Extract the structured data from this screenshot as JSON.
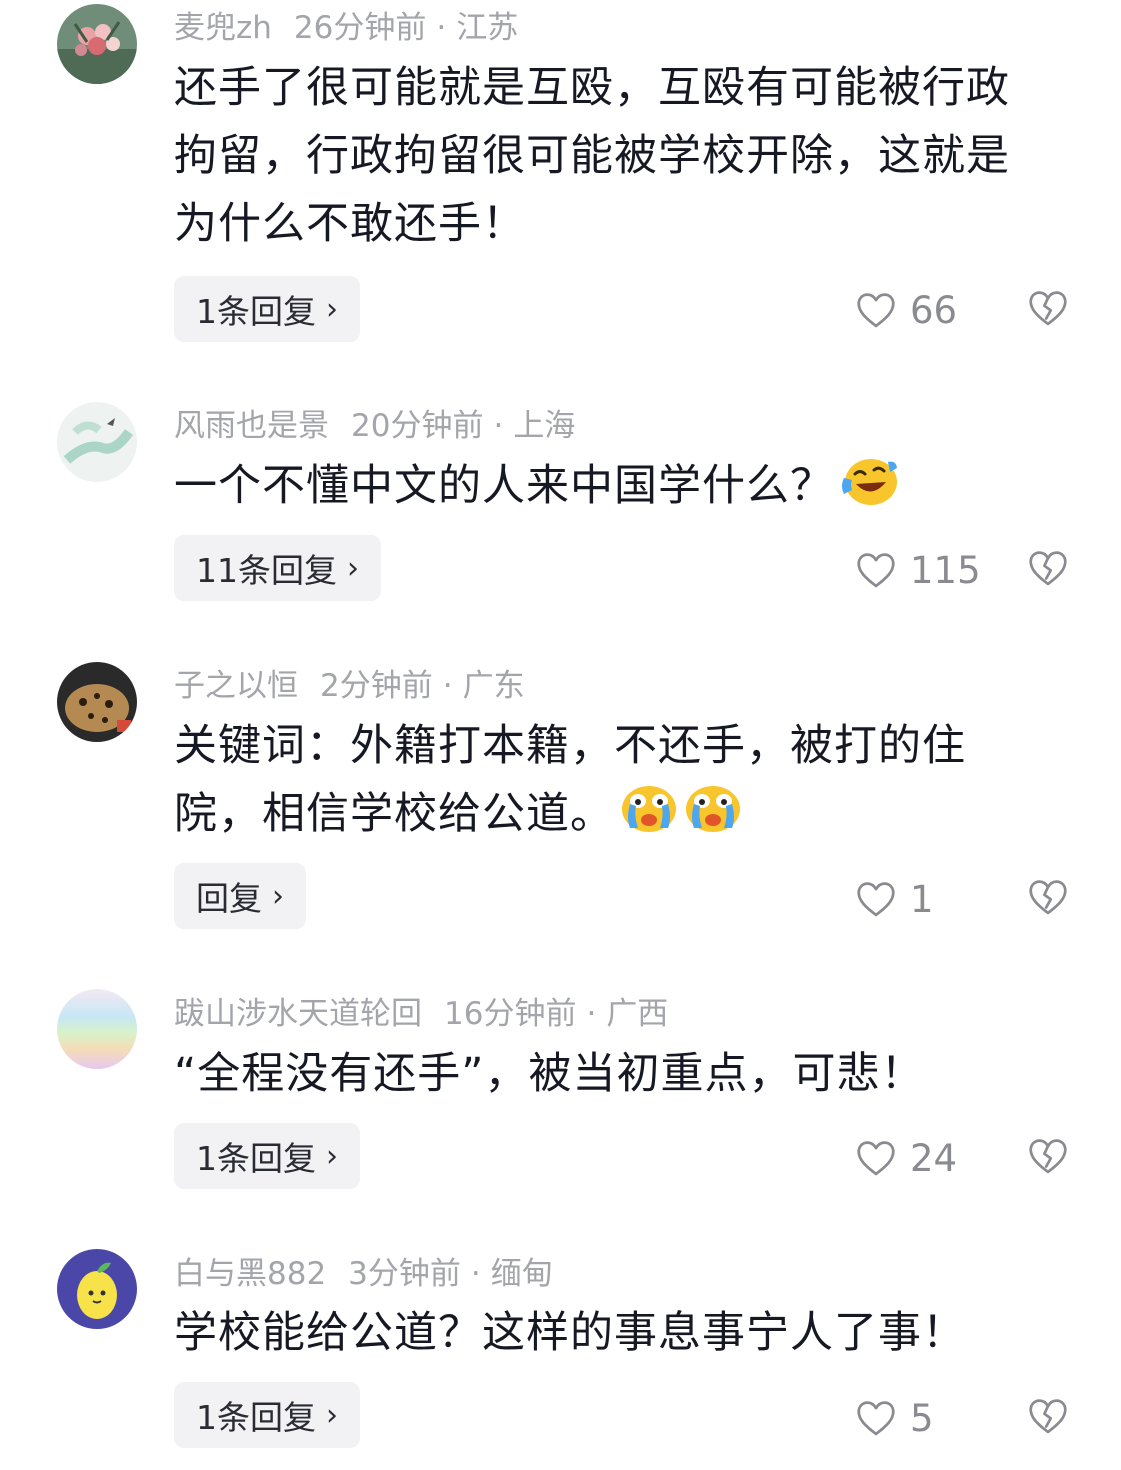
{
  "comments": [
    {
      "username": "麦兜zh",
      "time": "26分钟前",
      "location": "江苏",
      "lines": [
        "还手了很可能就是互殴，互殴有可能被行政",
        "拘留，行政拘留很可能被学校开除，这就是",
        "为什么不敢还手！"
      ],
      "reply_label": "1条回复",
      "likes": "66",
      "avatar_icon": "flower-bouquet-avatar"
    },
    {
      "username": "风雨也是景",
      "time": "20分钟前",
      "location": "上海",
      "lines": [
        "一个不懂中文的人来中国学什么？"
      ],
      "emojis": [
        "laughing-crying-emoji"
      ],
      "reply_label": "11条回复",
      "likes": "115",
      "avatar_icon": "watercolor-bird-avatar"
    },
    {
      "username": "子之以恒",
      "time": "2分钟前",
      "location": "广东",
      "lines": [
        "关键词：外籍打本籍，不还手，被打的住",
        "院，相信学校给公道。"
      ],
      "emojis": [
        "crying-emoji",
        "crying-emoji"
      ],
      "reply_label": "回复",
      "likes": "1",
      "avatar_icon": "leopard-avatar"
    },
    {
      "username": "跋山涉水天道轮回",
      "time": "16分钟前",
      "location": "广西",
      "lines": [
        "“全程没有还手”，被当初重点，可悲！"
      ],
      "reply_label": "1条回复",
      "likes": "24",
      "avatar_icon": "rainbow-gradient-avatar"
    },
    {
      "username": "白与黑882",
      "time": "3分钟前",
      "location": "缅甸",
      "lines": [
        "学校能给公道？这样的事息事宁人了事！"
      ],
      "reply_label": "1条回复",
      "likes": "5",
      "avatar_icon": "cartoon-lemon-avatar"
    }
  ],
  "meta_separator": "·",
  "colors": {
    "meta": "#a3a5ab",
    "text": "#161823",
    "reply_bg": "#f2f2f4",
    "count": "#8a8b91"
  }
}
